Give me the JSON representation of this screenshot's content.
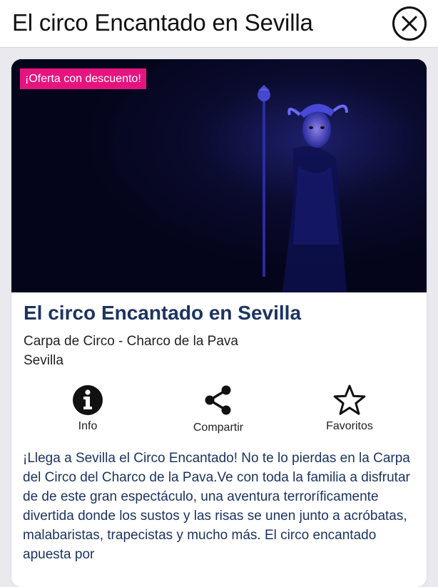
{
  "header": {
    "title": "El circo Encantado en Sevilla",
    "close_icon": "close-icon"
  },
  "card": {
    "badge": "¡Oferta con descuento!",
    "image": "dark blue stage photo of costumed performer with staff",
    "title": "El circo Encantado en Sevilla",
    "venue": "Carpa de Circo - Charco de la Pava",
    "city": "Sevilla",
    "actions": [
      {
        "label": "Info",
        "icon": "info-icon"
      },
      {
        "label": "Compartir",
        "icon": "share-icon"
      },
      {
        "label": "Favoritos",
        "icon": "star-icon"
      }
    ],
    "description": "¡Llega a Sevilla el Circo Encantado! No te lo pierdas en la Carpa del Circo del Charco de la Pava.Ve con toda la familia a disfrutar de de este gran espectáculo, una aventura terroríficamente divertida donde los sustos y las risas se unen junto a acróbatas, malabaristas, trapecistas y mucho más. El circo encantado apuesta por"
  },
  "colors": {
    "badge": "#e6147f",
    "title": "#1c3461",
    "hero_background": "#05061a",
    "hero_glow": "#3a3ad8"
  }
}
